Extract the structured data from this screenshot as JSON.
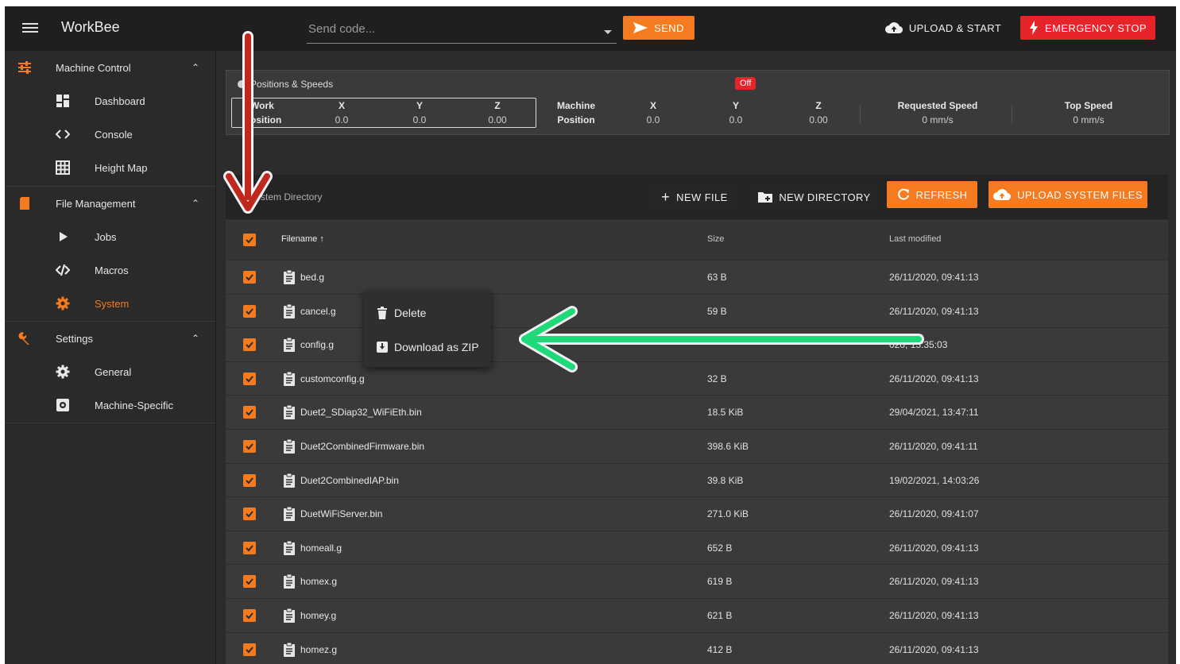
{
  "app": {
    "title": "WorkBee"
  },
  "topbar": {
    "send_placeholder": "Send code...",
    "send_label": "SEND",
    "upload_start_label": "UPLOAD & START",
    "estop_label": "EMERGENCY STOP"
  },
  "sidebar": {
    "groups": [
      {
        "label": "Machine Control",
        "items": [
          {
            "label": "Dashboard"
          },
          {
            "label": "Console"
          },
          {
            "label": "Height Map"
          }
        ]
      },
      {
        "label": "File Management",
        "items": [
          {
            "label": "Jobs"
          },
          {
            "label": "Macros"
          },
          {
            "label": "System"
          }
        ]
      },
      {
        "label": "Settings",
        "items": [
          {
            "label": "General"
          },
          {
            "label": "Machine-Specific"
          }
        ]
      }
    ]
  },
  "positions": {
    "title": "Positions & Speeds",
    "status": "Off",
    "work": {
      "label_line1": "Work",
      "label_line2": "osition",
      "x": "0.0",
      "y": "0.0",
      "z": "0.00"
    },
    "machine": {
      "label_line1": "Machine",
      "label_line2": "Position",
      "x": "0.0",
      "y": "0.0",
      "z": "0.00"
    },
    "axis_x": "X",
    "axis_y": "Y",
    "axis_z": "Z",
    "requested_speed": {
      "label": "Requested Speed",
      "value": "0 mm/s"
    },
    "top_speed": {
      "label": "Top Speed",
      "value": "0 mm/s"
    }
  },
  "files": {
    "directory_label": "stem Directory",
    "new_file_label": "NEW FILE",
    "new_directory_label": "NEW DIRECTORY",
    "refresh_label": "REFRESH",
    "upload_label": "UPLOAD SYSTEM FILES",
    "columns": {
      "filename": "Filename",
      "size": "Size",
      "modified": "Last modified"
    },
    "rows": [
      {
        "name": "bed.g",
        "size": "63 B",
        "modified": "26/11/2020, 09:41:13"
      },
      {
        "name": "cancel.g",
        "size": "59 B",
        "modified": "26/11/2020, 09:41:13"
      },
      {
        "name": "config.g",
        "size": "",
        "modified": "020, 15:35:03"
      },
      {
        "name": "customconfig.g",
        "size": "32 B",
        "modified": "26/11/2020, 09:41:13"
      },
      {
        "name": "Duet2_SDiap32_WiFiEth.bin",
        "size": "18.5 KiB",
        "modified": "29/04/2021, 13:47:11"
      },
      {
        "name": "Duet2CombinedFirmware.bin",
        "size": "398.6 KiB",
        "modified": "26/11/2020, 09:41:11"
      },
      {
        "name": "Duet2CombinedIAP.bin",
        "size": "39.8 KiB",
        "modified": "19/02/2021, 14:03:26"
      },
      {
        "name": "DuetWiFiServer.bin",
        "size": "271.0 KiB",
        "modified": "26/11/2020, 09:41:07"
      },
      {
        "name": "homeall.g",
        "size": "652 B",
        "modified": "26/11/2020, 09:41:13"
      },
      {
        "name": "homex.g",
        "size": "619 B",
        "modified": "26/11/2020, 09:41:13"
      },
      {
        "name": "homey.g",
        "size": "621 B",
        "modified": "26/11/2020, 09:41:13"
      },
      {
        "name": "homez.g",
        "size": "412 B",
        "modified": "26/11/2020, 09:41:13"
      }
    ]
  },
  "context_menu": {
    "delete_label": "Delete",
    "download_label": "Download as ZIP"
  },
  "colors": {
    "accent": "#f47b20",
    "danger": "#e8242b",
    "arrow_red": "#c0281e",
    "arrow_green": "#1ed87a"
  }
}
